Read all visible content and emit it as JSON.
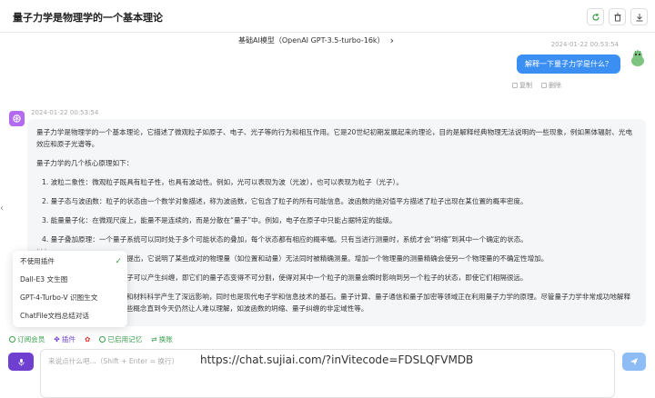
{
  "header": {
    "title": "量子力学是物理学的一个基本理论"
  },
  "model_bar": {
    "label": "基础AI模型（OpenAI GPT-3.5-turbo-16k）",
    "chevron": "›"
  },
  "user_message": {
    "timestamp": "2024-01-22 00:53:54",
    "text": "解释一下量子力学是什么？",
    "actions": [
      "复制",
      "删除"
    ]
  },
  "bot_message": {
    "timestamp": "2024-01-22 00:53:54",
    "intro": "量子力学是物理学的一个基本理论，它描述了微观粒子如原子、电子、光子等的行为和相互作用。它是20世纪初期发展起来的理论，目的是解释经典物理无法说明的一些现象，例如黑体辐射、光电效应和原子光谱等。",
    "principles_heading": "量子力学的几个核心原理如下：",
    "points": [
      "1.  波粒二象性：微观粒子既具有粒子性，也具有波动性。例如，光可以表现为波（光波），也可以表现为粒子（光子）。",
      "2.  量子态与波函数：粒子的状态由一个数学对象描述，称为波函数，它包含了粒子的所有可能信息。波函数的绝对值平方描述了粒子出现在某位置的概率密度。",
      "3.  能量量子化：在微观尺度上，能量不是连续的，而是分散在“量子”中。例如，电子在原子中只能占据特定的能级。",
      "4.  量子叠加原理：一个量子系统可以同时处于多个可能状态的叠加，每个状态都有相应的概率幅。只有当进行测量时，系统才会“坍缩”到其中一个确定的状态。",
      "5.  不确定性原理：由海森堡提出，它说明了某些成对的物理量（如位置和动量）无法同时被精确测量。增加一个物理量的测量精确会使另一个物理量的不确定性增加。",
      "6.  量子纠缠：两个或多个粒子可以产生纠缠，即它们的量子态变得不可分割，使得对其中一个粒子的测量会瞬时影响到另一个粒子的状态，即使它们相隔很远。"
    ],
    "conclusion": "量子力学对现代物理学、化学和材料科学产生了深远影响，同时也是现代电子学和信息技术的基石。量子计算、量子通信和量子加密等领域正在利用量子力学的原理。尽管量子力学非常成功地解释了微观世界的现象，但它的一些概念直到今天仍然让人难以理解，如波函数的坍缩、量子纠缠的非定域性等。"
  },
  "plugin_menu": {
    "items": [
      "不使用插件",
      "Dall-E3 文生图",
      "GPT-4-Turbo-V 识图生文",
      "ChatFile文档总结对话"
    ],
    "selected_index": 0
  },
  "toolbar": {
    "subscribe": "订阅会员",
    "plugins": "插件",
    "memory": "已启用记忆",
    "switch": "换账"
  },
  "input": {
    "placeholder": "来说点什么吧...（Shift + Enter = 换行）",
    "overlay_url": "https://chat.sujiai.com/?inVitecode=FDSLQFVMDB"
  },
  "colors": {
    "accent_purple": "#6f3fd0",
    "user_bubble": "#3b8ff3",
    "send_button": "#8ebdf5",
    "green": "#3a9e4d"
  }
}
